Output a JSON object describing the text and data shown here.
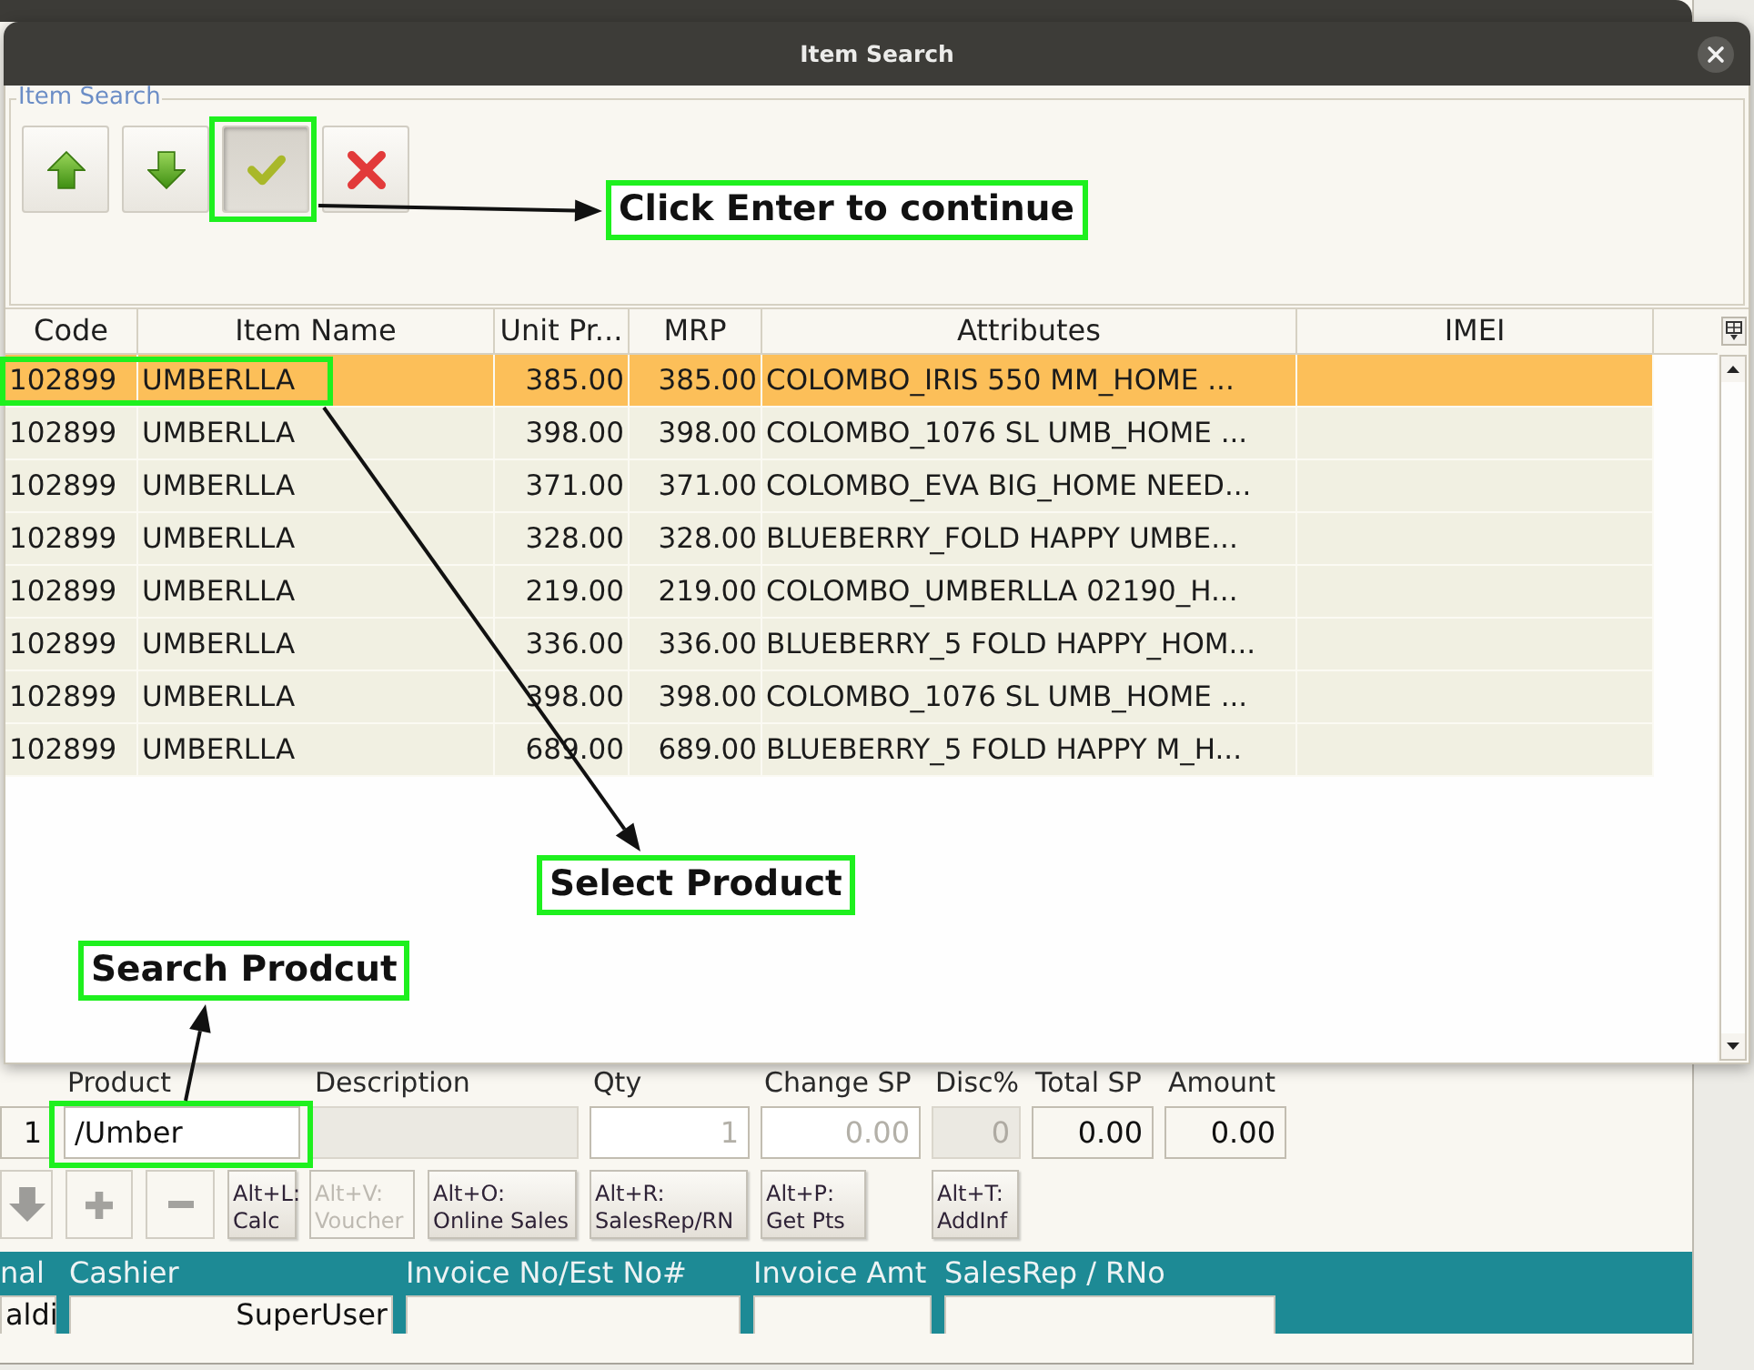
{
  "background_window": {
    "entry": {
      "row_number": "1",
      "fields": [
        {
          "label": "Product",
          "kind": "text",
          "disabled": false,
          "value": "/Umber"
        },
        {
          "label": "Description",
          "kind": "display",
          "disabled": true
        },
        {
          "label": "Qty",
          "kind": "number",
          "disabled": false,
          "placeholder": "1"
        },
        {
          "label": "Change SP",
          "kind": "number",
          "disabled": false,
          "placeholder": "0.00"
        },
        {
          "label": "Disc%",
          "kind": "display",
          "disabled": true,
          "value": "0"
        },
        {
          "label": "Total SP",
          "kind": "display",
          "disabled": false,
          "value": "0.00"
        },
        {
          "label": "Amount",
          "kind": "display",
          "disabled": false,
          "value": "0.00"
        }
      ]
    },
    "actions": [
      {
        "kind": "down",
        "disabled": false
      },
      {
        "kind": "add",
        "disabled": false
      },
      {
        "kind": "remove",
        "disabled": false
      },
      {
        "kind": "text",
        "shortcut": "Alt+L:",
        "label": "Calc",
        "disabled": false
      },
      {
        "kind": "text",
        "shortcut": "Alt+V:",
        "label": "Voucher",
        "disabled": true
      },
      {
        "kind": "text",
        "shortcut": "Alt+O:",
        "label": "Online Sales",
        "disabled": false
      },
      {
        "kind": "text",
        "shortcut": "Alt+R:",
        "label": "SalesRep/RN",
        "disabled": false
      },
      {
        "kind": "text",
        "shortcut": "Alt+P:",
        "label": "Get Pts",
        "disabled": false
      },
      {
        "kind": "text",
        "shortcut": "Alt+T:",
        "label": "AddInf",
        "disabled": false
      }
    ],
    "info_bar": {
      "columns": [
        "nal",
        "Cashier",
        "Invoice No/Est No#",
        "Invoice Amt",
        "SalesRep / RNo"
      ],
      "cells": [
        "aldi",
        "SuperUser"
      ]
    }
  },
  "dialog": {
    "title": "Item Search",
    "group_title": "Item Search",
    "toolbar": [
      {
        "kind": "up",
        "pressed": false
      },
      {
        "kind": "down",
        "pressed": false
      },
      {
        "kind": "accept",
        "pressed": true
      },
      {
        "kind": "cancel",
        "pressed": false
      }
    ],
    "table": {
      "columns": [
        "Code",
        "Item Name",
        "Unit Pr...",
        "MRP",
        "Attributes",
        "IMEI"
      ],
      "rows": [
        {
          "selected": true,
          "cells": [
            "102899",
            "UMBERLLA",
            "385.00",
            "385.00",
            "COLOMBO_IRIS 550 MM_HOME ..."
          ]
        },
        {
          "selected": false,
          "cells": [
            "102899",
            "UMBERLLA",
            "398.00",
            "398.00",
            "COLOMBO_1076 SL UMB_HOME ..."
          ]
        },
        {
          "selected": false,
          "cells": [
            "102899",
            "UMBERLLA",
            "371.00",
            "371.00",
            "COLOMBO_EVA BIG_HOME NEED..."
          ]
        },
        {
          "selected": false,
          "cells": [
            "102899",
            "UMBERLLA",
            "328.00",
            "328.00",
            "BLUEBERRY_FOLD HAPPY UMBE..."
          ]
        },
        {
          "selected": false,
          "cells": [
            "102899",
            "UMBERLLA",
            "219.00",
            "219.00",
            "COLOMBO_UMBERLLA 02190_H..."
          ]
        },
        {
          "selected": false,
          "cells": [
            "102899",
            "UMBERLLA",
            "336.00",
            "336.00",
            "BLUEBERRY_5 FOLD HAPPY_HOM..."
          ]
        },
        {
          "selected": false,
          "cells": [
            "102899",
            "UMBERLLA",
            "398.00",
            "398.00",
            "COLOMBO_1076 SL UMB_HOME ..."
          ]
        },
        {
          "selected": false,
          "cells": [
            "102899",
            "UMBERLLA",
            "689.00",
            "689.00",
            "BLUEBERRY_5 FOLD HAPPY M_H..."
          ]
        }
      ]
    }
  },
  "annotations": [
    {
      "text": "Click Enter to continue"
    },
    {
      "text": "Select Product"
    },
    {
      "text": "Search Prodcut"
    }
  ]
}
